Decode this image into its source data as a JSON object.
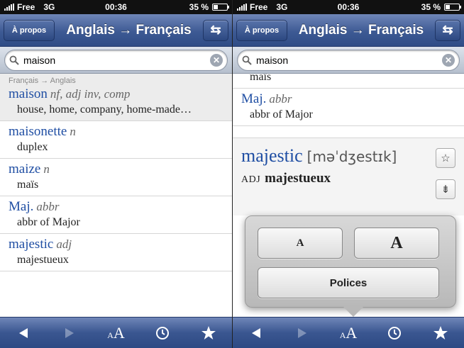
{
  "status": {
    "carrier": "Free",
    "network": "3G",
    "time": "00:36",
    "battery": "35 %",
    "battery_level": 0.35
  },
  "nav": {
    "about_label": "À propos",
    "title": "Anglais → Français",
    "swap_icon": "⇆"
  },
  "search": {
    "value": "maison"
  },
  "left_list": {
    "breadcrumb": "Français → Anglais",
    "rows": [
      {
        "word": "maison",
        "pos": "nf, adj inv, comp",
        "def": "house, home, company, home-made…"
      },
      {
        "word": "maisonette",
        "pos": "n",
        "def": "duplex"
      },
      {
        "word": "maize",
        "pos": "n",
        "def": "maïs"
      },
      {
        "word": "Maj.",
        "pos": "abbr",
        "def": "abbr of Major"
      },
      {
        "word": "majestic",
        "pos": "adj",
        "def": "majestueux"
      }
    ]
  },
  "right_list": {
    "partial_top": "maïs",
    "row": {
      "word": "Maj.",
      "pos": "abbr",
      "def": "abbr of Major"
    },
    "entry": {
      "word": "majestic",
      "ipa": "[məˈdʒestɪk]",
      "label": "ADJ",
      "translation": "majestueux"
    }
  },
  "popover": {
    "small_label": "A",
    "large_label": "A",
    "fonts_label": "Polices"
  },
  "tabbar": {
    "font_small": "A",
    "font_large": "A"
  },
  "colors": {
    "nav_blue": "#3d5a94",
    "link_blue": "#1f4ea3"
  }
}
